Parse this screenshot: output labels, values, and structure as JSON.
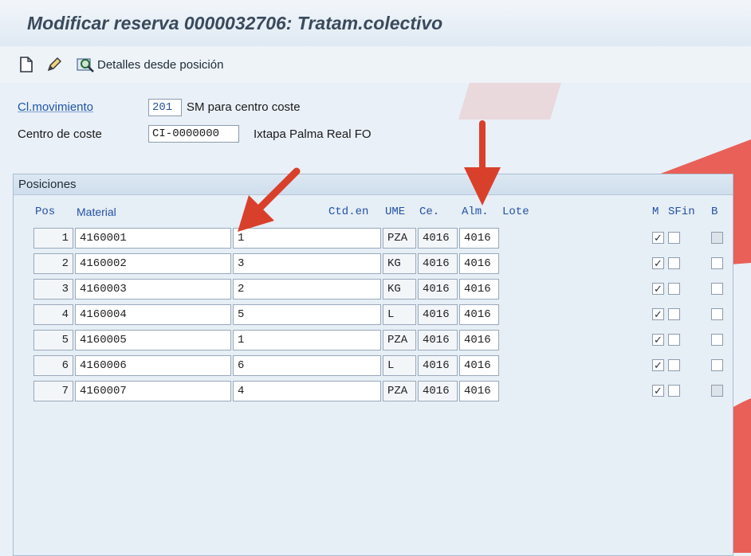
{
  "title": "Modificar reserva 0000032706: Tratam.colectivo",
  "toolbar": {
    "new_icon": "document-icon",
    "edit_icon": "pencil-icon",
    "details_icon": "magnifier-icon",
    "details_label": "Detalles desde posición"
  },
  "header": {
    "movement_type_label": "Cl.movimiento",
    "movement_type_value": "201",
    "movement_type_text": "SM para centro coste",
    "cost_center_label": "Centro de coste",
    "cost_center_value": "CI-0000000",
    "cost_center_text": "Ixtapa Palma Real FO"
  },
  "positions": {
    "group_title": "Posiciones",
    "columns": {
      "pos": "Pos",
      "material": "Material",
      "qty": "Ctd.en",
      "ume": "UME",
      "center": "Ce.",
      "warehouse": "Alm.",
      "lot": "Lote",
      "m": "M",
      "sfin": "SFin",
      "b": "B"
    },
    "rows": [
      {
        "pos": "1",
        "material": "4160001",
        "qty": "1",
        "ume": "PZA",
        "center": "4016",
        "warehouse": "4016",
        "m": true,
        "sfin": false,
        "b": false
      },
      {
        "pos": "2",
        "material": "4160002",
        "qty": "3",
        "ume": "KG",
        "center": "4016",
        "warehouse": "4016",
        "m": true,
        "sfin": false,
        "b": false
      },
      {
        "pos": "3",
        "material": "4160003",
        "qty": "2",
        "ume": "KG",
        "center": "4016",
        "warehouse": "4016",
        "m": true,
        "sfin": false,
        "b": false
      },
      {
        "pos": "4",
        "material": "4160004",
        "qty": "5",
        "ume": "L",
        "center": "4016",
        "warehouse": "4016",
        "m": true,
        "sfin": false,
        "b": false
      },
      {
        "pos": "5",
        "material": "4160005",
        "qty": "1",
        "ume": "PZA",
        "center": "4016",
        "warehouse": "4016",
        "m": true,
        "sfin": false,
        "b": false
      },
      {
        "pos": "6",
        "material": "4160006",
        "qty": "6",
        "ume": "L",
        "center": "4016",
        "warehouse": "4016",
        "m": true,
        "sfin": false,
        "b": false
      },
      {
        "pos": "7",
        "material": "4160007",
        "qty": "4",
        "ume": "PZA",
        "center": "4016",
        "warehouse": "4016",
        "m": true,
        "sfin": false,
        "b": false
      }
    ]
  },
  "colors": {
    "annotation_arrow": "#d9402b",
    "label_blue": "#2452a4",
    "watermark": "#e8463c"
  }
}
